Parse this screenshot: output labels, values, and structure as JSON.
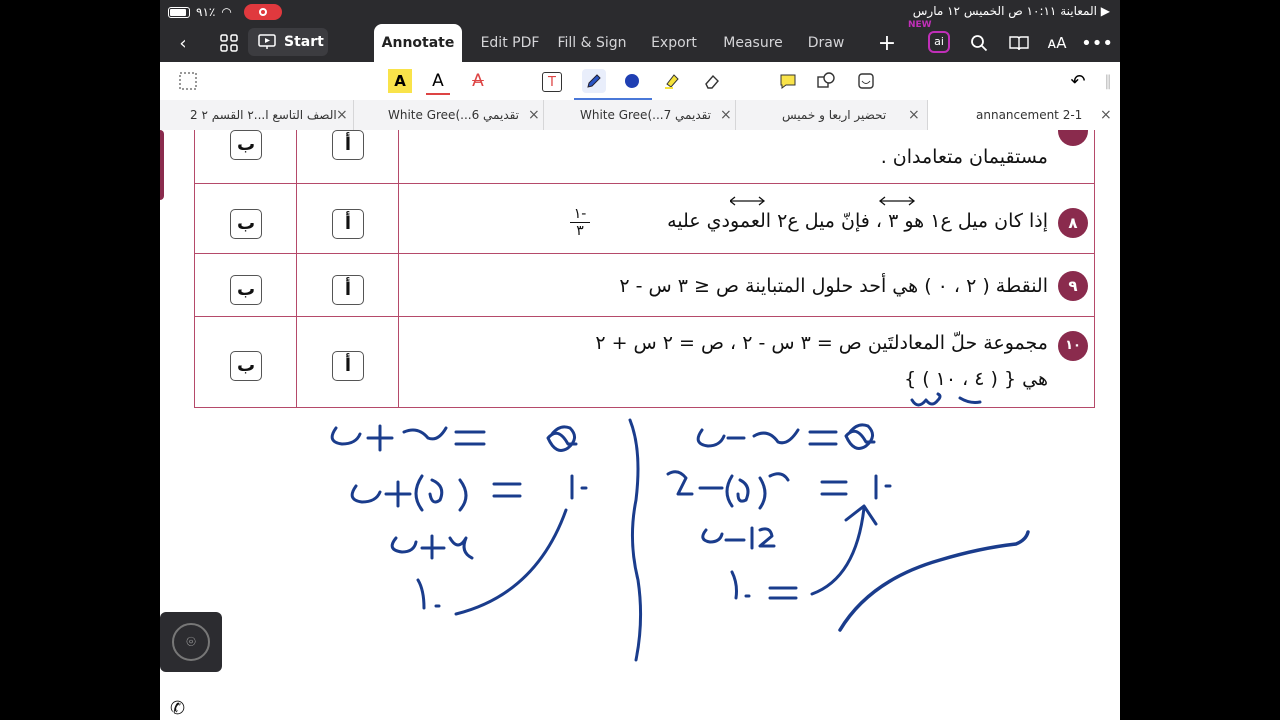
{
  "status_bar": {
    "battery_text": "٩١٪",
    "right_text": "▶ المعاينة  ١٠:١١ ص  الخميس ١٢ مارس"
  },
  "toolbar": {
    "start_label": "Start",
    "tabs": [
      "Annotate",
      "Edit PDF",
      "Fill & Sign",
      "Export",
      "Measure",
      "Draw"
    ],
    "active_tab": "Annotate",
    "new_tag": "NEW",
    "ai_label": "ai"
  },
  "doc_tabs": [
    {
      "title": "الصف التاسع ا...٢ القسم ٢ 2"
    },
    {
      "title": "White Gree(...تقديمي 6"
    },
    {
      "title": "White Gree(...تقديمي 7"
    },
    {
      "title": "تحضير اربعا و خميس"
    },
    {
      "title": "annancement 2-1"
    }
  ],
  "document": {
    "answer_a": "أ",
    "answer_b": "ب",
    "q7_tail": "مستقيمان متعامدان .",
    "q8": {
      "num": "٨",
      "text": "إذا كان ميل ع١ هو ٣ ، فإنّ ميل ع٢ العمودي عليه",
      "frac_num": "١-",
      "frac_den": "٣"
    },
    "q9": {
      "num": "٩",
      "text": "النقطة ( ٢ ، ٠ ) هي أحد حلول المتباينة ص ≤ ٣ س - ٢"
    },
    "q10": {
      "num": "١٠",
      "line1": "مجموعة حلّ المعادلتَين ص = ٣ س - ٢ ، ص = ٢ س + ٢",
      "line2": "هي { ( ٤ ، ١٠ ) }"
    }
  },
  "ink_color": "#1a3c8c",
  "accent_color": "#8a2b4d"
}
